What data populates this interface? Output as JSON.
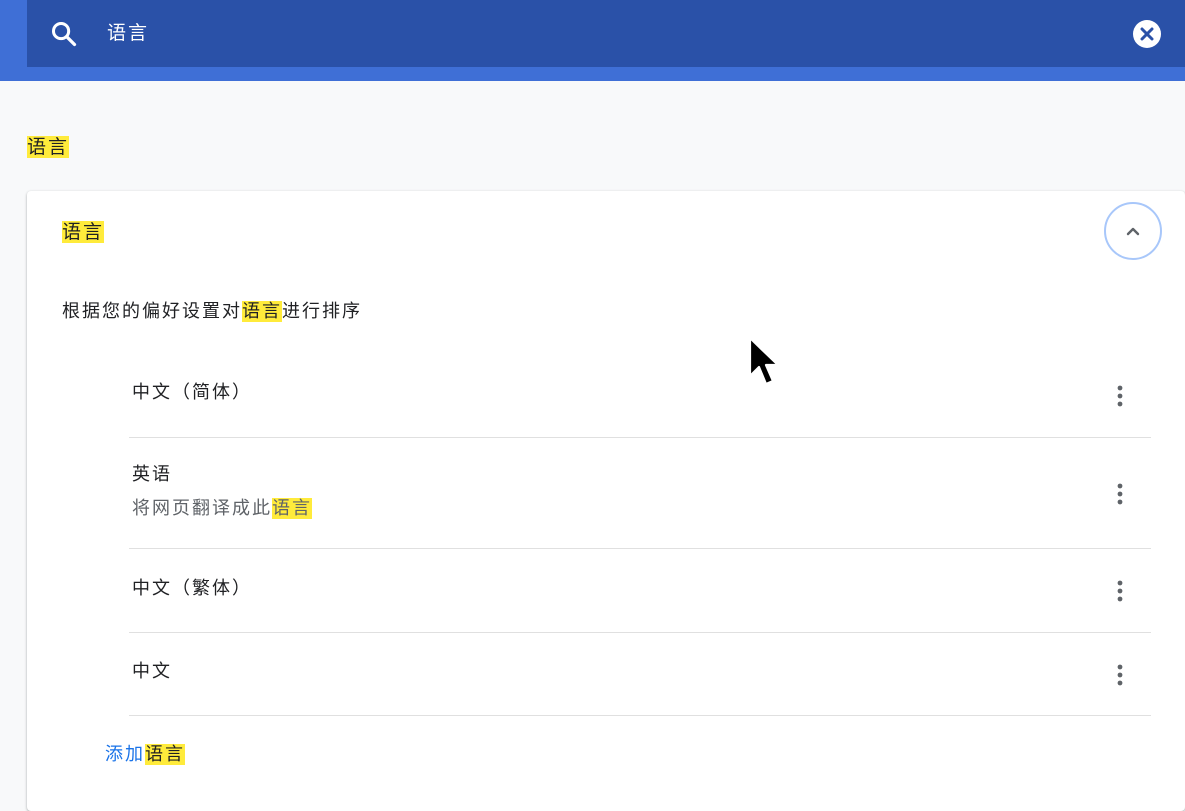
{
  "search": {
    "query": "语言",
    "search_icon": "search-icon",
    "clear_icon": "close-circle-icon"
  },
  "section": {
    "title": "语言"
  },
  "card": {
    "title": "语言",
    "collapse_icon": "chevron-up-icon",
    "description_prefix": "根据您的偏好设置对",
    "description_highlight": "语言",
    "description_suffix": "进行排序",
    "languages": [
      {
        "name": "中文（简体）"
      },
      {
        "name": "英语",
        "sub_prefix": "将网页翻译成此",
        "sub_highlight": "语言"
      },
      {
        "name": "中文（繁体）"
      },
      {
        "name": "中文"
      }
    ],
    "more_icon": "more-vert-icon",
    "add_prefix": "添加",
    "add_highlight": "语言"
  },
  "colors": {
    "header_band": "#3f6fd6",
    "search_bar": "#2a51a8",
    "highlight": "#ffeb3b",
    "link": "#1a73e8",
    "page_bg": "#f8f9fa"
  }
}
